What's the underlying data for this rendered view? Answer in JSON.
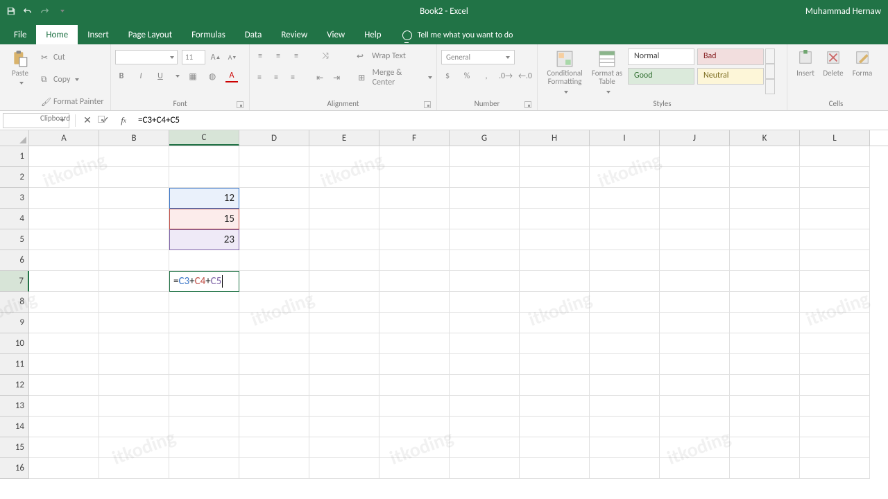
{
  "titlebar": {
    "doc_title": "Book2  -  Excel",
    "user_name": "Muhammad Hernaw"
  },
  "tabs": {
    "file": "File",
    "list": [
      "Home",
      "Insert",
      "Page Layout",
      "Formulas",
      "Data",
      "Review",
      "View",
      "Help"
    ],
    "active": "Home",
    "tell_me": "Tell me what you want to do"
  },
  "ribbon": {
    "clipboard": {
      "label": "Clipboard",
      "paste": "Paste",
      "cut": "Cut",
      "copy": "Copy",
      "format_painter": "Format Painter"
    },
    "font": {
      "label": "Font",
      "size": "11"
    },
    "alignment": {
      "label": "Alignment",
      "wrap": "Wrap Text",
      "merge": "Merge & Center"
    },
    "number": {
      "label": "Number",
      "format": "General"
    },
    "styles": {
      "label": "Styles",
      "normal": "Normal",
      "bad": "Bad",
      "good": "Good",
      "neutral": "Neutral",
      "cond": "Conditional Formatting",
      "fat": "Format as Table"
    },
    "cells": {
      "label": "Cells",
      "insert": "Insert",
      "delete": "Delete",
      "format": "Forma"
    }
  },
  "formula_bar": {
    "name_box": "",
    "formula": "=C3+C4+C5"
  },
  "grid": {
    "columns": [
      "A",
      "B",
      "C",
      "D",
      "E",
      "F",
      "G",
      "H",
      "I",
      "J",
      "K",
      "L"
    ],
    "row_count": 16,
    "active_cell": "C7",
    "cells": {
      "C3": "12",
      "C4": "15",
      "C5": "23"
    },
    "editing": {
      "cell": "C7",
      "tokens": [
        {
          "t": "=",
          "cls": "tok-eq"
        },
        {
          "t": "C3",
          "cls": "tok-c3"
        },
        {
          "t": "+",
          "cls": "tok-plus"
        },
        {
          "t": "C4",
          "cls": "tok-c4"
        },
        {
          "t": "+",
          "cls": "tok-plus"
        },
        {
          "t": "C5",
          "cls": "tok-c5"
        }
      ],
      "refs": [
        "C3",
        "C4",
        "C5"
      ]
    }
  },
  "chart_data": {
    "type": "table",
    "note": "Spreadsheet cells with an in-progress sum formula",
    "cells": [
      {
        "ref": "C3",
        "value": 12
      },
      {
        "ref": "C4",
        "value": 15
      },
      {
        "ref": "C5",
        "value": 23
      },
      {
        "ref": "C7",
        "formula": "=C3+C4+C5"
      }
    ]
  }
}
